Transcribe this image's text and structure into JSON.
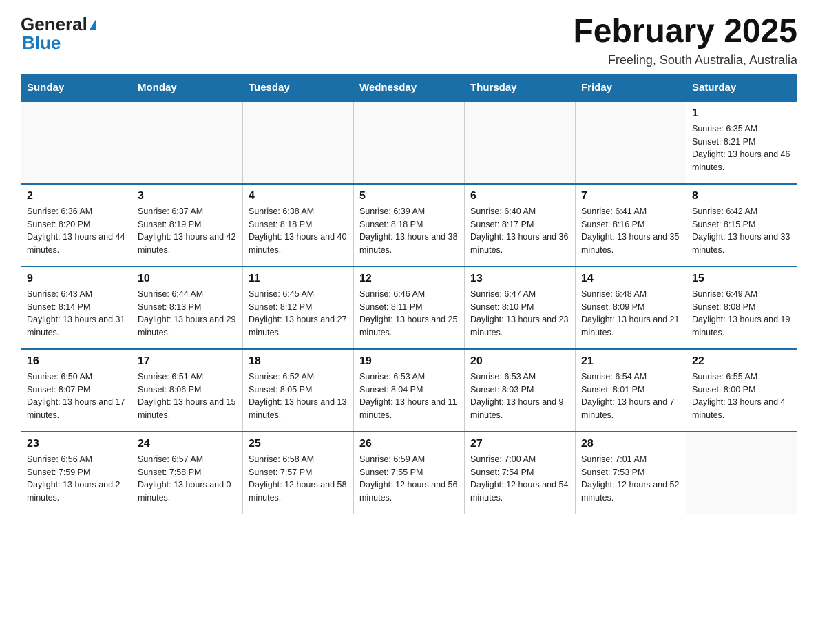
{
  "header": {
    "logo_general": "General",
    "logo_blue": "Blue",
    "title": "February 2025",
    "subtitle": "Freeling, South Australia, Australia"
  },
  "weekdays": [
    "Sunday",
    "Monday",
    "Tuesday",
    "Wednesday",
    "Thursday",
    "Friday",
    "Saturday"
  ],
  "weeks": [
    [
      {
        "day": "",
        "info": ""
      },
      {
        "day": "",
        "info": ""
      },
      {
        "day": "",
        "info": ""
      },
      {
        "day": "",
        "info": ""
      },
      {
        "day": "",
        "info": ""
      },
      {
        "day": "",
        "info": ""
      },
      {
        "day": "1",
        "info": "Sunrise: 6:35 AM\nSunset: 8:21 PM\nDaylight: 13 hours and 46 minutes."
      }
    ],
    [
      {
        "day": "2",
        "info": "Sunrise: 6:36 AM\nSunset: 8:20 PM\nDaylight: 13 hours and 44 minutes."
      },
      {
        "day": "3",
        "info": "Sunrise: 6:37 AM\nSunset: 8:19 PM\nDaylight: 13 hours and 42 minutes."
      },
      {
        "day": "4",
        "info": "Sunrise: 6:38 AM\nSunset: 8:18 PM\nDaylight: 13 hours and 40 minutes."
      },
      {
        "day": "5",
        "info": "Sunrise: 6:39 AM\nSunset: 8:18 PM\nDaylight: 13 hours and 38 minutes."
      },
      {
        "day": "6",
        "info": "Sunrise: 6:40 AM\nSunset: 8:17 PM\nDaylight: 13 hours and 36 minutes."
      },
      {
        "day": "7",
        "info": "Sunrise: 6:41 AM\nSunset: 8:16 PM\nDaylight: 13 hours and 35 minutes."
      },
      {
        "day": "8",
        "info": "Sunrise: 6:42 AM\nSunset: 8:15 PM\nDaylight: 13 hours and 33 minutes."
      }
    ],
    [
      {
        "day": "9",
        "info": "Sunrise: 6:43 AM\nSunset: 8:14 PM\nDaylight: 13 hours and 31 minutes."
      },
      {
        "day": "10",
        "info": "Sunrise: 6:44 AM\nSunset: 8:13 PM\nDaylight: 13 hours and 29 minutes."
      },
      {
        "day": "11",
        "info": "Sunrise: 6:45 AM\nSunset: 8:12 PM\nDaylight: 13 hours and 27 minutes."
      },
      {
        "day": "12",
        "info": "Sunrise: 6:46 AM\nSunset: 8:11 PM\nDaylight: 13 hours and 25 minutes."
      },
      {
        "day": "13",
        "info": "Sunrise: 6:47 AM\nSunset: 8:10 PM\nDaylight: 13 hours and 23 minutes."
      },
      {
        "day": "14",
        "info": "Sunrise: 6:48 AM\nSunset: 8:09 PM\nDaylight: 13 hours and 21 minutes."
      },
      {
        "day": "15",
        "info": "Sunrise: 6:49 AM\nSunset: 8:08 PM\nDaylight: 13 hours and 19 minutes."
      }
    ],
    [
      {
        "day": "16",
        "info": "Sunrise: 6:50 AM\nSunset: 8:07 PM\nDaylight: 13 hours and 17 minutes."
      },
      {
        "day": "17",
        "info": "Sunrise: 6:51 AM\nSunset: 8:06 PM\nDaylight: 13 hours and 15 minutes."
      },
      {
        "day": "18",
        "info": "Sunrise: 6:52 AM\nSunset: 8:05 PM\nDaylight: 13 hours and 13 minutes."
      },
      {
        "day": "19",
        "info": "Sunrise: 6:53 AM\nSunset: 8:04 PM\nDaylight: 13 hours and 11 minutes."
      },
      {
        "day": "20",
        "info": "Sunrise: 6:53 AM\nSunset: 8:03 PM\nDaylight: 13 hours and 9 minutes."
      },
      {
        "day": "21",
        "info": "Sunrise: 6:54 AM\nSunset: 8:01 PM\nDaylight: 13 hours and 7 minutes."
      },
      {
        "day": "22",
        "info": "Sunrise: 6:55 AM\nSunset: 8:00 PM\nDaylight: 13 hours and 4 minutes."
      }
    ],
    [
      {
        "day": "23",
        "info": "Sunrise: 6:56 AM\nSunset: 7:59 PM\nDaylight: 13 hours and 2 minutes."
      },
      {
        "day": "24",
        "info": "Sunrise: 6:57 AM\nSunset: 7:58 PM\nDaylight: 13 hours and 0 minutes."
      },
      {
        "day": "25",
        "info": "Sunrise: 6:58 AM\nSunset: 7:57 PM\nDaylight: 12 hours and 58 minutes."
      },
      {
        "day": "26",
        "info": "Sunrise: 6:59 AM\nSunset: 7:55 PM\nDaylight: 12 hours and 56 minutes."
      },
      {
        "day": "27",
        "info": "Sunrise: 7:00 AM\nSunset: 7:54 PM\nDaylight: 12 hours and 54 minutes."
      },
      {
        "day": "28",
        "info": "Sunrise: 7:01 AM\nSunset: 7:53 PM\nDaylight: 12 hours and 52 minutes."
      },
      {
        "day": "",
        "info": ""
      }
    ]
  ]
}
